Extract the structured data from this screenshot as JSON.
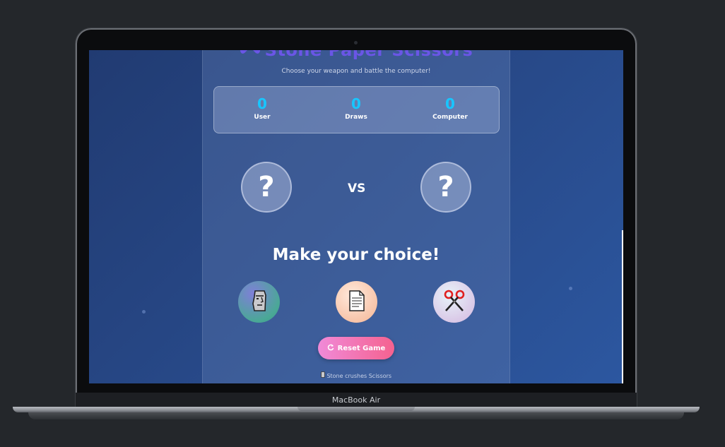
{
  "device": {
    "label": "MacBook Air"
  },
  "app": {
    "title": "Stone Paper Scissors",
    "subtitle": "Choose your weapon and battle the computer!"
  },
  "scoreboard": {
    "user": {
      "value": "0",
      "label": "User"
    },
    "draws": {
      "value": "0",
      "label": "Draws"
    },
    "computer": {
      "value": "0",
      "label": "Computer"
    }
  },
  "battle": {
    "user_choice": "?",
    "vs_label": "VS",
    "computer_choice": "?"
  },
  "prompt": "Make your choice!",
  "weapons": [
    {
      "name": "Stone",
      "icon": "moai-icon"
    },
    {
      "name": "Paper",
      "icon": "page-icon"
    },
    {
      "name": "Scissors",
      "icon": "scissors-icon"
    }
  ],
  "reset": {
    "label": "Reset Game",
    "icon": "refresh-icon"
  },
  "hint": "Stone crushes Scissors",
  "colors": {
    "accent": "#18c6ff",
    "title": "#6a56e6",
    "reset_start": "#f08ad8",
    "reset_end": "#f5628f"
  }
}
